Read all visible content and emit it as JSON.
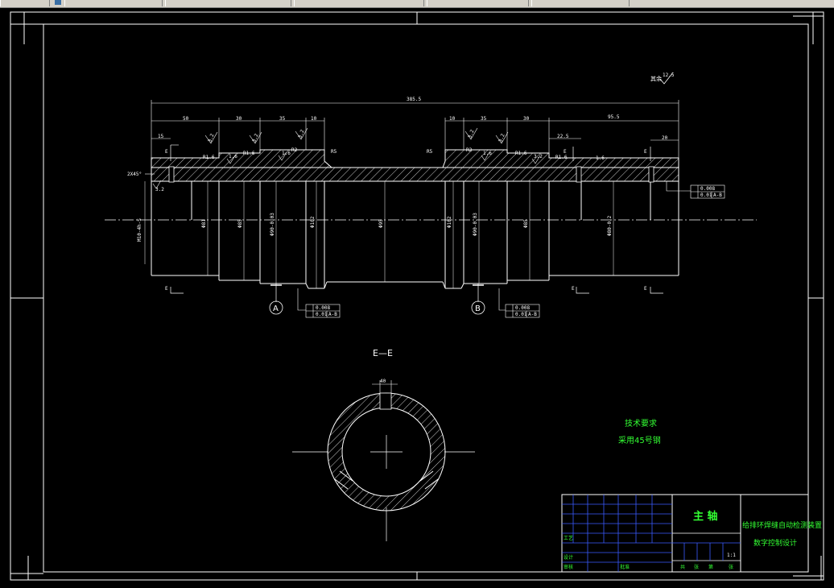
{
  "window": {
    "tabs": [
      "",
      "",
      "",
      "",
      ""
    ]
  },
  "drawing": {
    "roughness_default": "12.5",
    "roughness_symbol": "其余",
    "dims_top": {
      "overall": "385.5",
      "left_segments": [
        "50",
        "30",
        "35",
        "10"
      ],
      "right_segments": [
        "10",
        "35",
        "30"
      ],
      "right_long": "95.5",
      "left_small": "15",
      "right_small": "22.5",
      "right_end": "20"
    },
    "chamfer": "2X45°",
    "roughness_marks": [
      "3.2",
      "3.2",
      "3.2",
      "1.6",
      "1.6",
      "3.2",
      "3.2",
      "1.6",
      "3.2",
      "3.2"
    ],
    "fillets": [
      "R1.6",
      "R1.6",
      "R2",
      "R5",
      "R5",
      "R2",
      "R1.6",
      "R1.6"
    ],
    "diameters": [
      "Φ81",
      "Φ85",
      "Φ90-0.03",
      "Φ102",
      "Φ95",
      "Φ102",
      "Φ90-0.03",
      "Φ85",
      "Φ80-0.2"
    ],
    "thread": "M10-4h-S",
    "section_marker": "E",
    "datums": [
      "A",
      "B"
    ],
    "tolerance_boxes": [
      {
        "row1": "0.008",
        "row2": "0.01",
        "ref": "A-B"
      },
      {
        "row1": "0.008",
        "row2": "0.01",
        "ref": "A-B"
      },
      {
        "row1": "0.008",
        "row2": "0.01",
        "ref": "A-B"
      }
    ],
    "section_title": "E—E",
    "section_dim": "40",
    "tech_title": "技术要求",
    "tech_note": "采用45号钢"
  },
  "title_block": {
    "part_name": "主 轴",
    "project_line1": "给排环焊缝自动检测装置",
    "project_line2": "数字控制设计",
    "scale": "1:1",
    "row_labels": [
      "设计",
      "审核",
      "工艺",
      "批准"
    ],
    "bottom_labels": [
      "共",
      "张",
      "第",
      "张"
    ]
  }
}
